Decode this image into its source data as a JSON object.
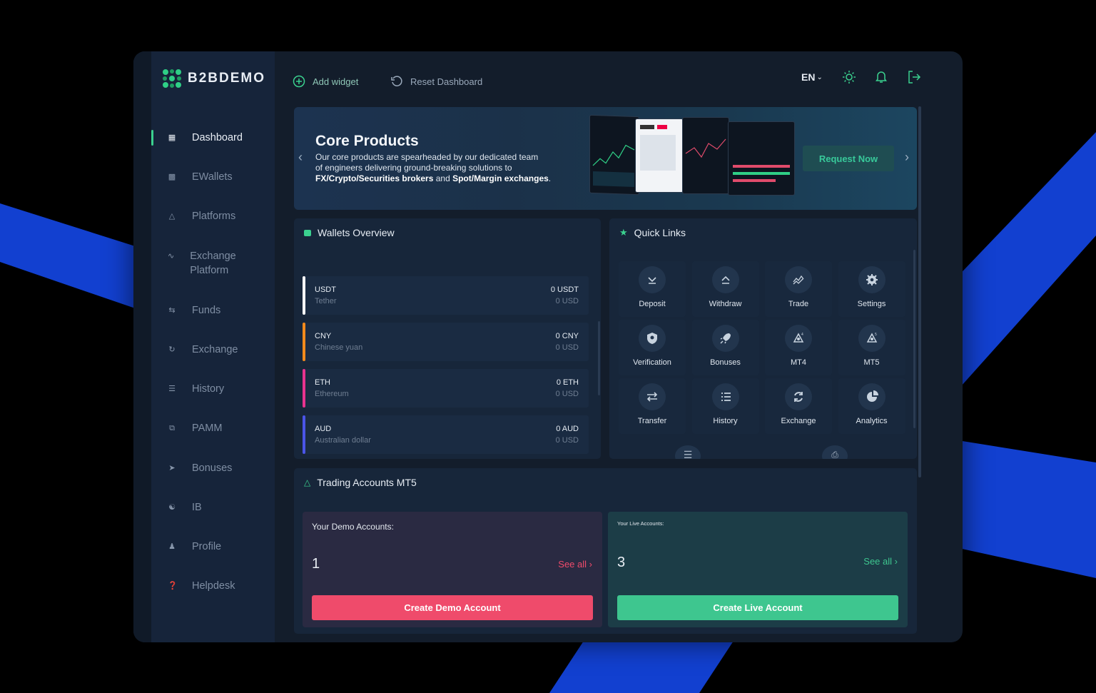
{
  "brand": {
    "name": "B2BDEMO"
  },
  "topbar": {
    "add_widget": "Add widget",
    "reset_dashboard": "Reset Dashboard",
    "language": "EN"
  },
  "sidebar": {
    "items": [
      {
        "label": "Dashboard",
        "icon": "grid-icon"
      },
      {
        "label": "EWallets",
        "icon": "wallet-icon"
      },
      {
        "label": "Platforms",
        "icon": "triangle-icon"
      },
      {
        "label": "Exchange Platform",
        "icon": "chart-line-icon"
      },
      {
        "label": "Funds",
        "icon": "transfer-icon"
      },
      {
        "label": "Exchange",
        "icon": "refresh-icon"
      },
      {
        "label": "History",
        "icon": "list-icon"
      },
      {
        "label": "PAMM",
        "icon": "copy-icon"
      },
      {
        "label": "Bonuses",
        "icon": "rocket-icon"
      },
      {
        "label": "IB",
        "icon": "users-icon"
      },
      {
        "label": "Profile",
        "icon": "user-icon"
      },
      {
        "label": "Helpdesk",
        "icon": "help-icon"
      }
    ]
  },
  "banner": {
    "title": "Core Products",
    "text_line1": "Our core products are spearheaded by our dedicated team",
    "text_line2": "of engineers delivering ground-breaking solutions to",
    "text_bold1": "FX/Crypto/Securities brokers",
    "text_and": " and ",
    "text_bold2": "Spot/Margin exchanges",
    "text_end": ".",
    "cta": "Request Now"
  },
  "wallets": {
    "title": "Wallets Overview",
    "rows": [
      {
        "code": "USDT",
        "name": "Tether",
        "amount": "0 USDT",
        "usd": "0 USD",
        "color": "#ffffff"
      },
      {
        "code": "CNY",
        "name": "Chinese yuan",
        "amount": "0 CNY",
        "usd": "0 USD",
        "color": "#f28a1c"
      },
      {
        "code": "ETH",
        "name": "Ethereum",
        "amount": "0 ETH",
        "usd": "0 USD",
        "color": "#e8338f"
      },
      {
        "code": "AUD",
        "name": "Australian dollar",
        "amount": "0 AUD",
        "usd": "0 USD",
        "color": "#4b55e8"
      }
    ]
  },
  "quick_links": {
    "title": "Quick Links",
    "items": [
      {
        "label": "Deposit",
        "icon": "deposit-icon"
      },
      {
        "label": "Withdraw",
        "icon": "withdraw-icon"
      },
      {
        "label": "Trade",
        "icon": "trade-icon"
      },
      {
        "label": "Settings",
        "icon": "settings-icon"
      },
      {
        "label": "Verification",
        "icon": "shield-icon"
      },
      {
        "label": "Bonuses",
        "icon": "rocket-icon"
      },
      {
        "label": "MT4",
        "icon": "mt4-icon"
      },
      {
        "label": "MT5",
        "icon": "mt5-icon"
      },
      {
        "label": "Transfer",
        "icon": "transfer-icon"
      },
      {
        "label": "History",
        "icon": "history-icon"
      },
      {
        "label": "Exchange",
        "icon": "exchange-icon"
      },
      {
        "label": "Analytics",
        "icon": "analytics-icon"
      }
    ]
  },
  "trading": {
    "title": "Trading Accounts MT5",
    "demo": {
      "label": "Your Demo Accounts:",
      "count": "1",
      "see_all": "See all",
      "button": "Create Demo Account",
      "color": "#ef4b6b"
    },
    "live": {
      "label": "Your Live Accounts:",
      "count": "3",
      "see_all": "See all",
      "button": "Create Live Account",
      "color": "#3ec68f"
    }
  }
}
